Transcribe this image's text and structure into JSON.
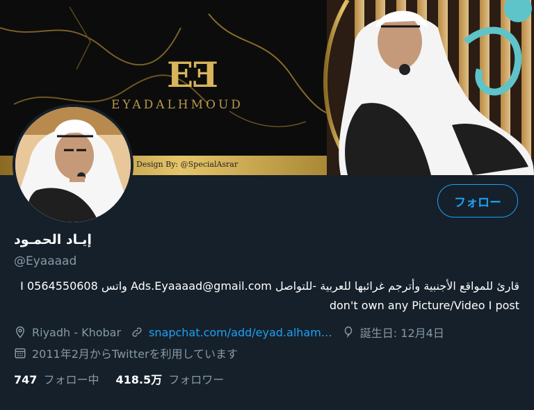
{
  "banner": {
    "logo_mark": "EƎ",
    "brand_text": "EYADALHMOUD",
    "credit": "Design By: @SpecialAsrar"
  },
  "profile": {
    "follow_label": "フォロー",
    "name": "إيـاد الحمـود",
    "handle": "@Eyaaaad",
    "bio_line1": "قارئ للمواقع الأجنبية وأترجم غرائبها للعربية -للتواصل Ads.Eyaaaad@gmail.com واتس 0564550608  I",
    "bio_line2": "don't own any Picture/Video I post",
    "location": "Riyadh - Khobar",
    "website": "snapchat.com/add/eyad.alham…",
    "birthday": "誕生日: 12月4日",
    "joined": "2011年2月からTwitterを利用しています"
  },
  "stats": {
    "following_count": "747",
    "following_label": "フォロー中",
    "followers_count": "418.5万",
    "followers_label": "フォロワー"
  },
  "colors": {
    "background": "#15202b",
    "accent": "#1da1f2",
    "secondary_text": "#8899a6",
    "gold": "#c9a64a"
  },
  "icons": [
    "location-icon",
    "link-icon",
    "birthday-balloon-icon",
    "calendar-icon"
  ]
}
